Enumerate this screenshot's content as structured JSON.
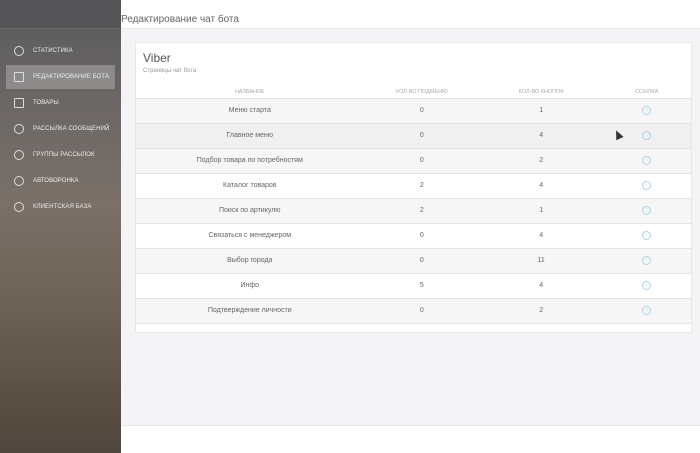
{
  "header": {
    "title": "Редактирование чат бота"
  },
  "sidebar": {
    "items": [
      {
        "label": "Статистика",
        "icon": "chart-pie-icon"
      },
      {
        "label": "Редактирование бота",
        "icon": "clipboard-icon",
        "active": true
      },
      {
        "label": "Товары",
        "icon": "box-icon"
      },
      {
        "label": "Рассылка сообщений",
        "icon": "envelope-icon"
      },
      {
        "label": "Группы рассылок",
        "icon": "users-icon"
      },
      {
        "label": "Автоворонка",
        "icon": "globe-icon"
      },
      {
        "label": "Клиентская база",
        "icon": "brain-icon"
      }
    ]
  },
  "card": {
    "title": "Viber",
    "subtitle": "Страницы чат бота",
    "columns": [
      "Название",
      "Кол-во подменю",
      "Кол-во кнопок",
      "Ссылка"
    ],
    "rows": [
      {
        "name": "Меню старта",
        "submenus": "0",
        "buttons": "1"
      },
      {
        "name": "Главное меню",
        "submenus": "0",
        "buttons": "4"
      },
      {
        "name": "Подбор товара по потребностям",
        "submenus": "0",
        "buttons": "2"
      },
      {
        "name": "Каталог товаров",
        "submenus": "2",
        "buttons": "4"
      },
      {
        "name": "Поиск по артикулю",
        "submenus": "2",
        "buttons": "1"
      },
      {
        "name": "Связаться с менеджером",
        "submenus": "0",
        "buttons": "4"
      },
      {
        "name": "Выбор города",
        "submenus": "0",
        "buttons": "11"
      },
      {
        "name": "Инфо",
        "submenus": "5",
        "buttons": "4"
      },
      {
        "name": "Подтверждение личности",
        "submenus": "0",
        "buttons": "2"
      }
    ]
  },
  "link_icon": "›"
}
